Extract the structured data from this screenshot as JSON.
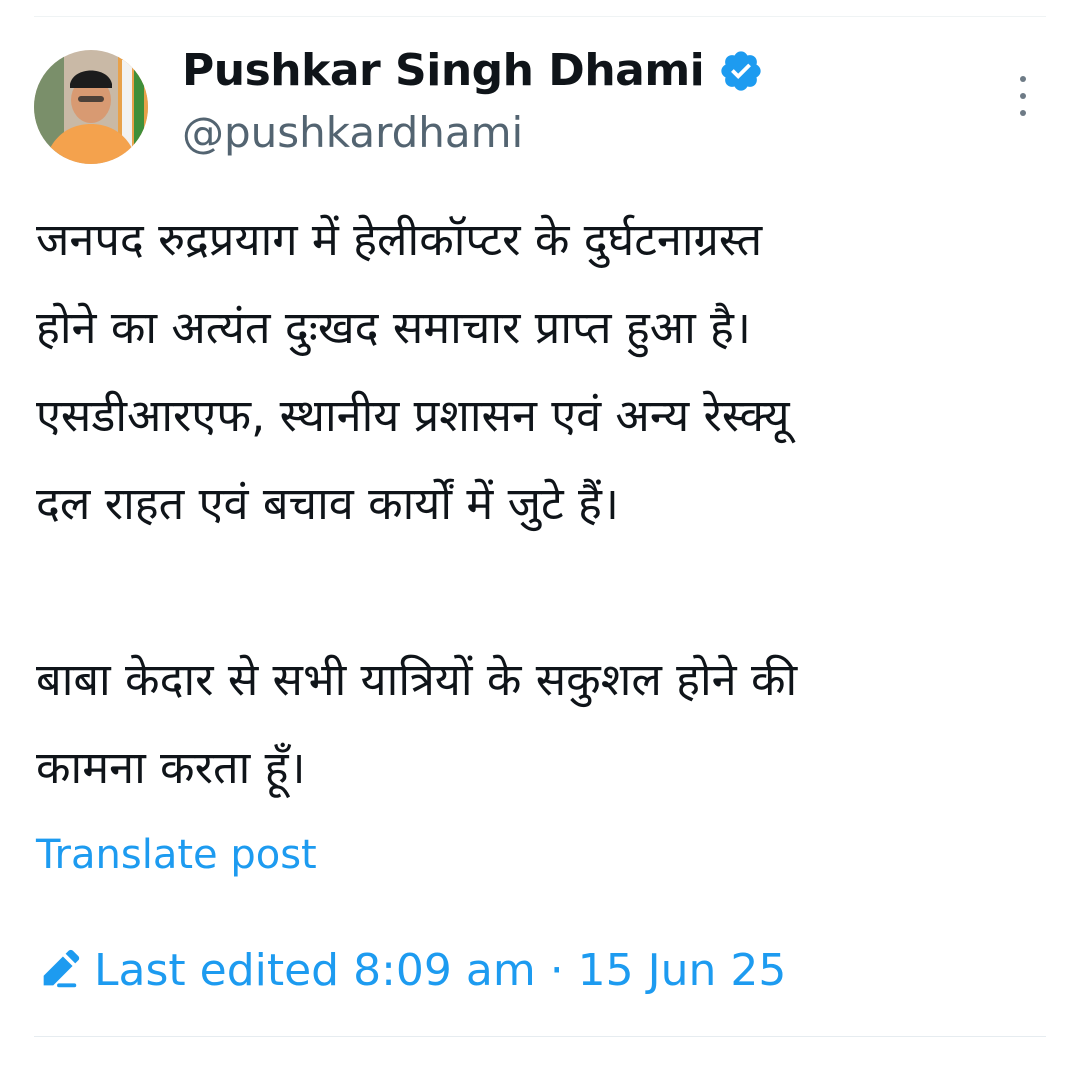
{
  "author": {
    "display_name": "Pushkar Singh Dhami",
    "handle": "@pushkardhami",
    "verified": true
  },
  "tweet": {
    "paragraphs": [
      {
        "lines": [
          "जनपद रुद्रप्रयाग में हेलीकॉप्टर के दुर्घटनाग्रस्त",
          "होने का अत्यंत दुःखद समाचार प्राप्त हुआ है।",
          "एसडीआरएफ, स्थानीय प्रशासन एवं अन्य रेस्क्यू",
          "दल राहत एवं बचाव कार्यों में जुटे हैं।"
        ]
      },
      {
        "lines": [
          "बाबा केदार से सभी यात्रियों के सकुशल होने की",
          "कामना करता हूँ।"
        ]
      }
    ]
  },
  "translate_label": "Translate post",
  "edited": {
    "text": "Last edited 8:09 am · 15 Jun 25"
  },
  "icons": {
    "verified": "verified-badge-icon",
    "more": "more-vertical-icon",
    "edit": "pencil-icon"
  },
  "colors": {
    "accent": "#1d9bf0",
    "text": "#0f1419",
    "secondary": "#536471"
  }
}
